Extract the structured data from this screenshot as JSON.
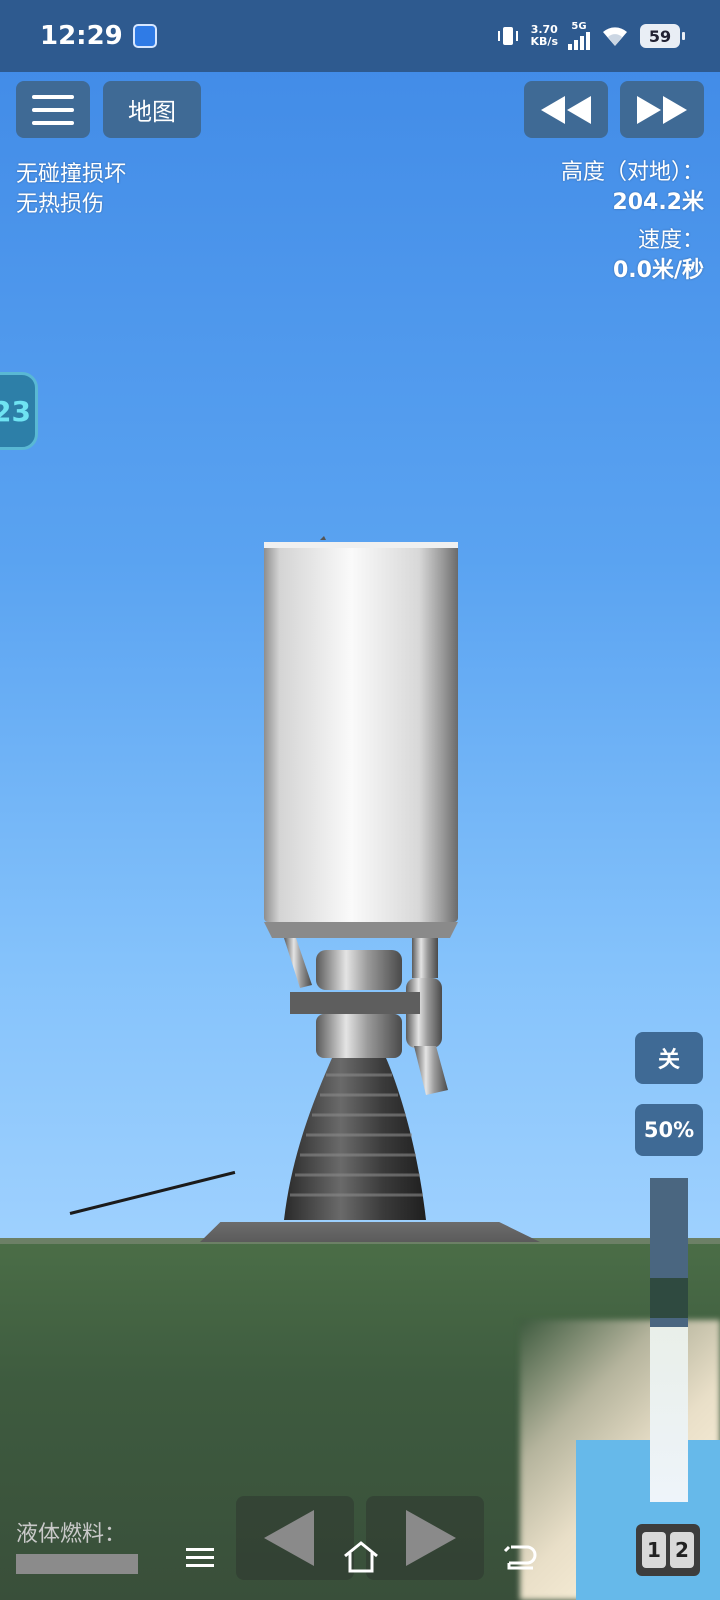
{
  "status_bar": {
    "time": "12:29",
    "net_speed_value": "3.70",
    "net_speed_unit": "KB/s",
    "network": "5G",
    "battery": "59",
    "icons": [
      "gallery-icon",
      "vibrate-icon",
      "signal-icon",
      "wifi-icon",
      "battery-icon"
    ]
  },
  "hud": {
    "map_label": "地图",
    "damage_collision": "无碰撞损坏",
    "damage_heat": "无热损伤",
    "altitude_label": "高度（对地）：",
    "altitude_value": "204.2米",
    "velocity_label": "速度：",
    "velocity_value": "0.0米/秒",
    "side_tab_text": "23"
  },
  "engine": {
    "toggle_label": "关",
    "throttle_label": "50%",
    "throttle_level": 0.54
  },
  "bottom": {
    "fuel_label": "液体燃料：",
    "stage_1": "1",
    "stage_2": "2"
  },
  "colors": {
    "hud_button": "#3f6a95",
    "sky_top": "#3f89e6",
    "sky_bottom": "#a6d5ff",
    "ground": "#3e5b3f"
  }
}
